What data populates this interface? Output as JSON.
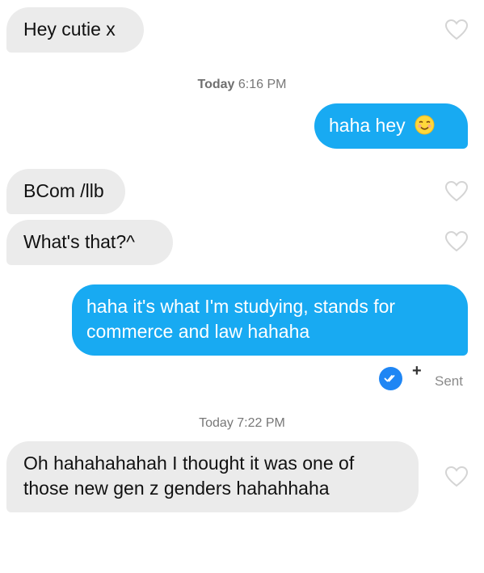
{
  "messages": [
    {
      "direction": "incoming",
      "text": "Hey cutie x"
    },
    {
      "direction": "incoming",
      "text": "BCom /llb"
    },
    {
      "direction": "incoming",
      "text": "What's that?^"
    },
    {
      "direction": "incoming",
      "text": "Oh hahahahahah I thought it was one of",
      "text_line2": "those new gen z genders hahahhaha"
    },
    {
      "direction": "outgoing",
      "text": "haha hey",
      "emoji": "smiling-face-icon"
    },
    {
      "direction": "outgoing",
      "text": "haha it's what I'm studying, stands for",
      "text_line2": "commerce and law hahaha"
    }
  ],
  "timestamps": [
    {
      "day": "Today",
      "time": "6:16 PM"
    },
    {
      "day": "Today",
      "time": "7:22 PM"
    }
  ],
  "status": {
    "label": "Sent"
  },
  "colors": {
    "incoming_bubble": "#ebebeb",
    "outgoing_bubble": "#18aaf2",
    "read_check": "#1f86f4"
  },
  "icons": [
    "heart-outline-icon",
    "double-check-icon",
    "plus-icon",
    "smiling-face-icon"
  ]
}
